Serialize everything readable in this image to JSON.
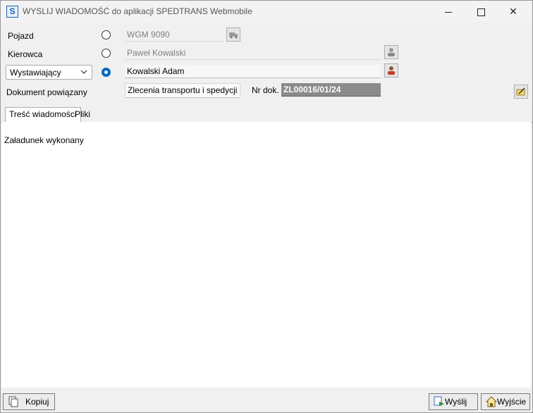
{
  "window": {
    "title": "WYSLIJ WIADOMOŚĆ do aplikacji SPEDTRANS Webmobile",
    "app_icon_letter": "S",
    "controls": [
      "minimize",
      "maximize",
      "close"
    ]
  },
  "form": {
    "pojazd": {
      "label": "Pojazd",
      "value": "WGM 9090",
      "selected": false,
      "button_icon": "truck-icon"
    },
    "kierowca": {
      "label": "Kierowca",
      "value": "Paweł Kowalski",
      "selected": false,
      "button_icon": "person-icon"
    },
    "wystawiajacy": {
      "selected_option": "Wystawiający",
      "value": "Kowalski Adam",
      "selected": true,
      "button_icon": "person-red-icon"
    },
    "dokument": {
      "label": "Dokument powiązany",
      "value": "Zlecenia transportu i spedycji",
      "nr_label": "Nr dok.",
      "nr_value": "ZL00016/01/24",
      "edit_icon": "edit-note-icon"
    }
  },
  "tabs": [
    {
      "label": "Treść wiadomości",
      "active": true
    },
    {
      "label": "Pliki",
      "active": false
    }
  ],
  "message": {
    "text": "Załadunek wykonany"
  },
  "buttons": {
    "copy": "Kopiuj",
    "send": "Wyślij",
    "exit": "Wyjście"
  },
  "colors": {
    "accent": "#0067c0",
    "doc_number_bg": "#8b8b8b"
  }
}
